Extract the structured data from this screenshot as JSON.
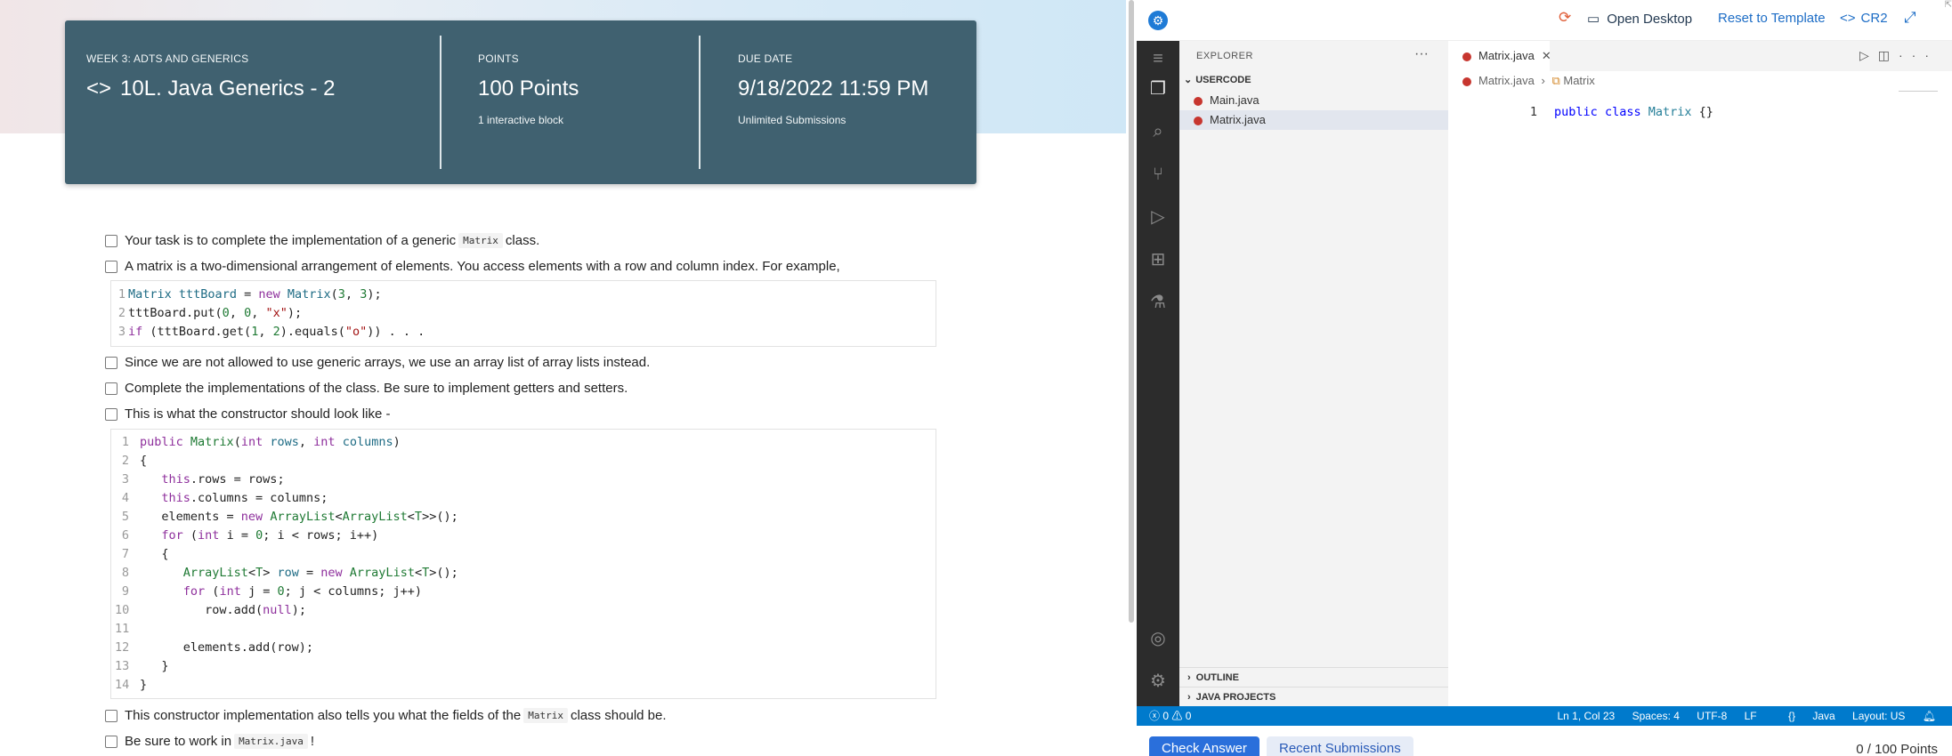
{
  "header": {
    "week_label": "WEEK 3: ADTS AND GENERICS",
    "title": "10L. Java Generics - 2",
    "points_label": "POINTS",
    "points_value": "100 Points",
    "points_note": "1 interactive block",
    "due_label": "DUE DATE",
    "due_value": "9/18/2022 11:59 PM",
    "due_note": "Unlimited Submissions"
  },
  "tasks": {
    "t1_pre": "Your task is to complete the implementation of a generic",
    "t1_code": "Matrix",
    "t1_post": "class.",
    "t2": "A matrix is a two-dimensional arrangement of elements. You access elements with a row and column index. For example,",
    "t3": " Since we are not allowed to use generic arrays, we use an array list of array lists instead.",
    "t4": "Complete the implementations of the class. Be sure to implement getters and setters.",
    "t5": "This is what the constructor should look like -",
    "t6_pre": "This constructor implementation also tells you what the fields of the",
    "t6_code": "Matrix",
    "t6_post": "class should be.",
    "t7_pre": "Be sure to work in",
    "t7_code": "Matrix.java",
    "t7_post": "!"
  },
  "example_code": [
    {
      "ln": "1",
      "text": "Matrix tttBoard = new Matrix(3, 3);"
    },
    {
      "ln": "2",
      "text": "tttBoard.put(0, 0, \"x\");"
    },
    {
      "ln": "3",
      "text": "if (tttBoard.get(1, 2).equals(\"o\")) . . ."
    }
  ],
  "constructor_code": [
    {
      "ln": "1",
      "text": "public Matrix(int rows, int columns)"
    },
    {
      "ln": "2",
      "text": "{"
    },
    {
      "ln": "3",
      "text": "   this.rows = rows;"
    },
    {
      "ln": "4",
      "text": "   this.columns = columns;"
    },
    {
      "ln": "5",
      "text": "   elements = new ArrayList<ArrayList<T>>();"
    },
    {
      "ln": "6",
      "text": "   for (int i = 0; i < rows; i++)"
    },
    {
      "ln": "7",
      "text": "   {"
    },
    {
      "ln": "8",
      "text": "      ArrayList<T> row = new ArrayList<T>();"
    },
    {
      "ln": "9",
      "text": "      for (int j = 0; j < columns; j++)"
    },
    {
      "ln": "10",
      "text": "         row.add(null);"
    },
    {
      "ln": "11",
      "text": ""
    },
    {
      "ln": "12",
      "text": "      elements.add(row);"
    },
    {
      "ln": "13",
      "text": "   }"
    },
    {
      "ln": "14",
      "text": "}"
    }
  ],
  "topbar": {
    "open_desktop": "Open Desktop",
    "reset": "Reset to Template",
    "cr2": "CR2"
  },
  "explorer": {
    "title": "EXPLORER",
    "section": "USERCODE",
    "files": [
      "Main.java",
      "Matrix.java"
    ],
    "outline": "OUTLINE",
    "java_projects": "JAVA PROJECTS"
  },
  "editor": {
    "tab": "Matrix.java",
    "crumb_file": "Matrix.java",
    "crumb_symbol": "Matrix",
    "line_no": "1",
    "code_kw1": "public",
    "code_kw2": "class",
    "code_cls": "Matrix",
    "code_rest": "{}"
  },
  "statusbar": {
    "problems": "0",
    "warnings": "0",
    "position": "Ln 1, Col 23",
    "spaces": "Spaces: 4",
    "encoding": "UTF-8",
    "eol": "LF",
    "language": "Java",
    "layout": "Layout: US"
  },
  "footer": {
    "check": "Check Answer",
    "recent": "Recent Submissions",
    "points": "0  / 100 Points"
  }
}
